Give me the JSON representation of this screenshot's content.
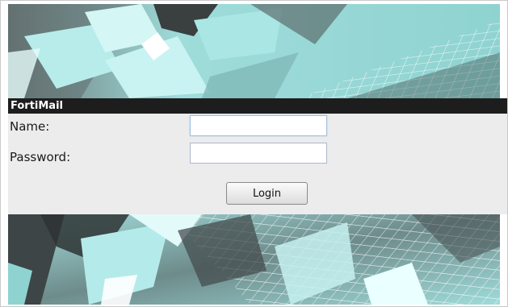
{
  "login": {
    "title": "FortiMail",
    "name_label": "Name:",
    "name_value": "",
    "password_label": "Password:",
    "password_value": "",
    "login_button": "Login"
  },
  "colors": {
    "art_cyan": "#8fd3d1",
    "title_bar": "#1d1d1d",
    "panel": "#ececec"
  }
}
